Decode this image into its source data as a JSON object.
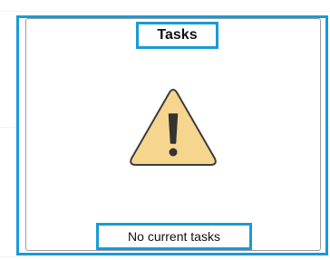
{
  "tile": {
    "title": "Tasks",
    "icon": "warning-triangle-icon",
    "message": "No current tasks"
  },
  "colors": {
    "highlight_border": "#1a9ad6",
    "tile_border": "#9a9a9a",
    "warning_fill": "#f6d58f",
    "warning_stroke": "#3c3c3c",
    "exclamation": "#333333"
  }
}
